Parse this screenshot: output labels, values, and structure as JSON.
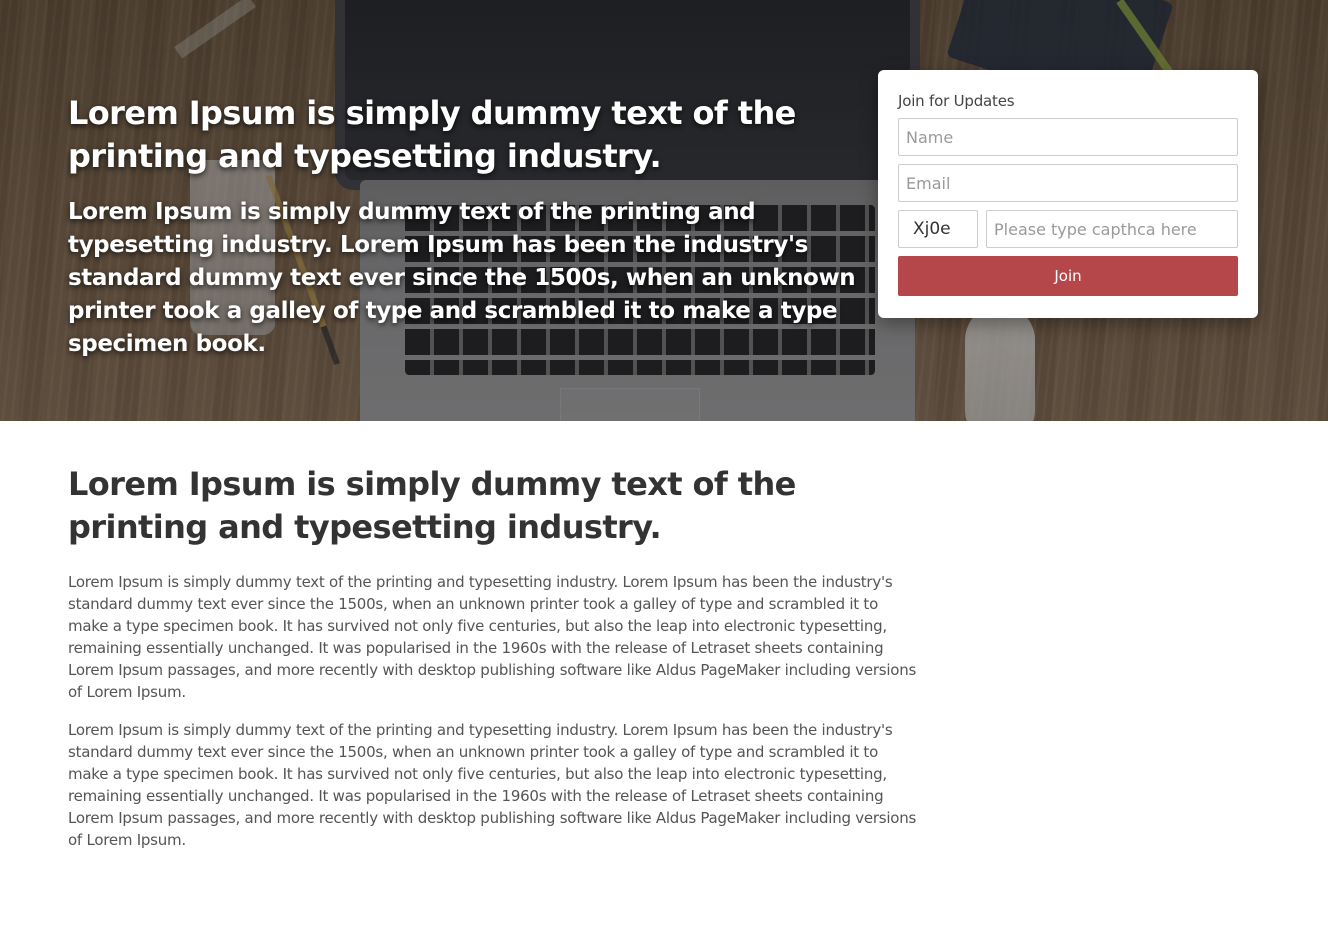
{
  "hero": {
    "title": "Lorem Ipsum is simply dummy text of the printing and typesetting industry.",
    "lead": "Lorem Ipsum is simply dummy text of the printing and typesetting industry. Lorem Ipsum has been the industry's standard dummy text ever since the 1500s, when an unknown printer took a galley of type and scrambled it to make a type specimen book."
  },
  "signup": {
    "title": "Join for Updates",
    "name_placeholder": "Name",
    "email_placeholder": "Email",
    "captcha_code": "Xj0e",
    "captcha_placeholder": "Please type capthca here",
    "join_label": "Join",
    "button_color": "#b5474a"
  },
  "main": {
    "title": "Lorem Ipsum is simply dummy text of the printing and typesetting industry.",
    "paragraphs": [
      "Lorem Ipsum is simply dummy text of the printing and typesetting industry. Lorem Ipsum has been the industry's standard dummy text ever since the 1500s, when an unknown printer took a galley of type and scrambled it to make a type specimen book. It has survived not only five centuries, but also the leap into electronic typesetting, remaining essentially unchanged. It was popularised in the 1960s with the release of Letraset sheets containing Lorem Ipsum passages, and more recently with desktop publishing software like Aldus PageMaker including versions of Lorem Ipsum.",
      "Lorem Ipsum is simply dummy text of the printing and typesetting industry. Lorem Ipsum has been the industry's standard dummy text ever since the 1500s, when an unknown printer took a galley of type and scrambled it to make a type specimen book. It has survived not only five centuries, but also the leap into electronic typesetting, remaining essentially unchanged. It was popularised in the 1960s with the release of Letraset sheets containing Lorem Ipsum passages, and more recently with desktop publishing software like Aldus PageMaker including versions of Lorem Ipsum."
    ]
  }
}
